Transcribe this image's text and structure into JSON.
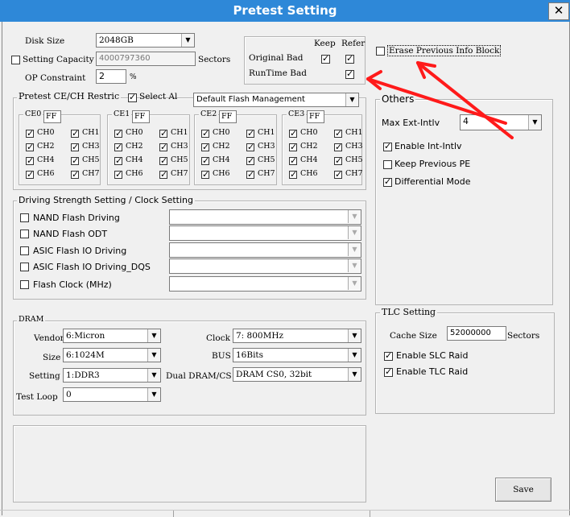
{
  "window": {
    "title": "Pretest Setting",
    "close_glyph": "✕"
  },
  "top": {
    "disk_size_label": "Disk Size",
    "disk_size_value": "2048GB",
    "setting_capacity_label": "Setting Capacity",
    "setting_capacity_checked": false,
    "setting_capacity_value": "4000797360",
    "sectors_label": "Sectors",
    "op_constraint_label": "OP Constraint",
    "op_constraint_value": "2",
    "percent_label": "%"
  },
  "bad_block": {
    "keep_label": "Keep",
    "refer_label": "Refer",
    "original_bad_label": "Original Bad",
    "original_bad_keep": true,
    "original_bad_refer": true,
    "runtime_bad_label": "RunTime Bad",
    "runtime_bad_refer": true
  },
  "erase": {
    "label": "Erase Previous Info Block",
    "checked": false
  },
  "ce_ch": {
    "group_label": "Pretest CE/CH Restric",
    "select_all_label": "Select Al",
    "select_all_checked": true,
    "flash_management_value": "Default Flash Management",
    "ces": [
      {
        "label": "CE0",
        "value": "FF",
        "channels": [
          "CH0",
          "CH1",
          "CH2",
          "CH3",
          "CH4",
          "CH5",
          "CH6",
          "CH7"
        ]
      },
      {
        "label": "CE1",
        "value": "FF",
        "channels": [
          "CH0",
          "CH1",
          "CH2",
          "CH3",
          "CH4",
          "CH5",
          "CH6",
          "CH7"
        ]
      },
      {
        "label": "CE2",
        "value": "FF",
        "channels": [
          "CH0",
          "CH1",
          "CH2",
          "CH3",
          "CH4",
          "CH5",
          "CH6",
          "CH7"
        ]
      },
      {
        "label": "CE3",
        "value": "FF",
        "channels": [
          "CH0",
          "CH1",
          "CH2",
          "CH3",
          "CH4",
          "CH5",
          "CH6",
          "CH7"
        ]
      }
    ]
  },
  "others": {
    "group_label": "Others",
    "max_ext_intlv_label": "Max Ext-Intlv",
    "max_ext_intlv_value": "4",
    "enable_int_intlv_label": "Enable Int-Intlv",
    "enable_int_intlv_checked": true,
    "keep_previous_pe_label": "Keep Previous PE",
    "keep_previous_pe_checked": false,
    "differential_mode_label": "Differential Mode",
    "differential_mode_checked": true
  },
  "driving": {
    "group_label": "Driving Strength Setting / Clock Setting",
    "items": [
      {
        "label": "NAND Flash Driving",
        "checked": false
      },
      {
        "label": "NAND Flash ODT",
        "checked": false
      },
      {
        "label": "ASIC Flash IO Driving",
        "checked": false
      },
      {
        "label": "ASIC Flash IO Driving_DQS",
        "checked": false
      },
      {
        "label": "Flash Clock (MHz)",
        "checked": false
      }
    ]
  },
  "dram": {
    "group_label": "DRAM",
    "vendor_label": "Vendor",
    "vendor_value": "6:Micron",
    "size_label": "Size",
    "size_value": "6:1024M",
    "setting_label": "Setting",
    "setting_value": "1:DDR3",
    "test_loop_label": "Test  Loop",
    "test_loop_value": "0",
    "clock_label": "Clock",
    "clock_value": "7: 800MHz",
    "bus_label": "BUS",
    "bus_value": "16Bits",
    "dual_label": "Dual DRAM/CS",
    "dual_value": "DRAM CS0, 32bit"
  },
  "tlc": {
    "group_label": "TLC Setting",
    "cache_size_label": "Cache  Size",
    "cache_size_value": "52000000",
    "sectors_label": "Sectors",
    "enable_slc_raid_label": "Enable SLC Raid",
    "enable_slc_raid_checked": true,
    "enable_tlc_raid_label": "Enable TLC Raid",
    "enable_tlc_raid_checked": true
  },
  "footer": {
    "save_label": "Save"
  },
  "colors": {
    "titlebar": "#2e88d8",
    "annotation": "#ff0000"
  }
}
